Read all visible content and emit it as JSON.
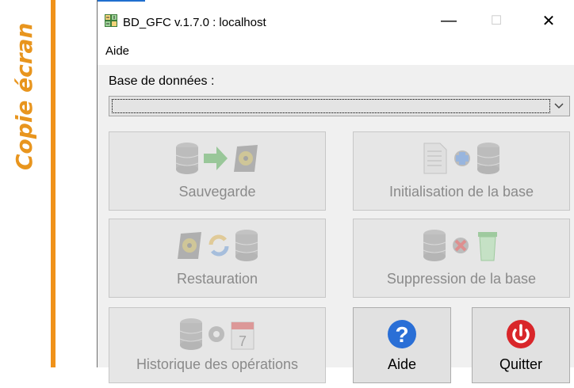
{
  "side_caption": "Copie écran",
  "window": {
    "title": "BD_GFC v.1.7.0 : localhost",
    "minimize_symbol": "—",
    "maximize_symbol": "☐",
    "close_symbol": "✕"
  },
  "menu": {
    "aide": "Aide"
  },
  "database": {
    "label": "Base de données :",
    "selected": ""
  },
  "buttons": {
    "sauvegarde": "Sauvegarde",
    "initialisation": "Initialisation de la base",
    "restauration": "Restauration",
    "suppression": "Suppression de la base",
    "historique": "Historique des opérations",
    "aide": "Aide",
    "quitter": "Quitter"
  },
  "colors": {
    "accent_orange": "#f0921a",
    "help_blue": "#2a6fd6",
    "quit_red": "#d9262a"
  }
}
